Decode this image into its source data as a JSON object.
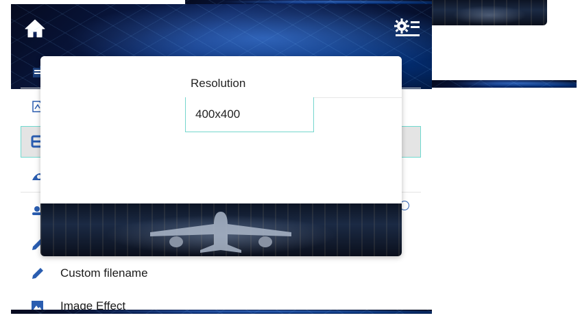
{
  "header": {
    "home_icon": "home-icon",
    "settings_icon": "settings-list-icon"
  },
  "menu": {
    "items": [
      {
        "icon": "calendar-icon",
        "label": ""
      },
      {
        "icon": "image-edit-icon",
        "label": ""
      },
      {
        "icon": "resolution-icon",
        "label": "",
        "selected": true
      },
      {
        "icon": "watermark-icon",
        "label": ""
      },
      {
        "icon": "user-icon",
        "label": ""
      },
      {
        "icon": "pencil-icon",
        "label": ""
      },
      {
        "icon": "pencil-icon",
        "label": "Custom filename"
      },
      {
        "icon": "picture-icon",
        "label": "Image Effect"
      }
    ]
  },
  "dialog": {
    "label": "Resolution",
    "value": "400x400"
  },
  "colors": {
    "accent": "#2a5db0",
    "highlight_border": "#6fd9cf",
    "selected_row": "#e4e4e4"
  }
}
